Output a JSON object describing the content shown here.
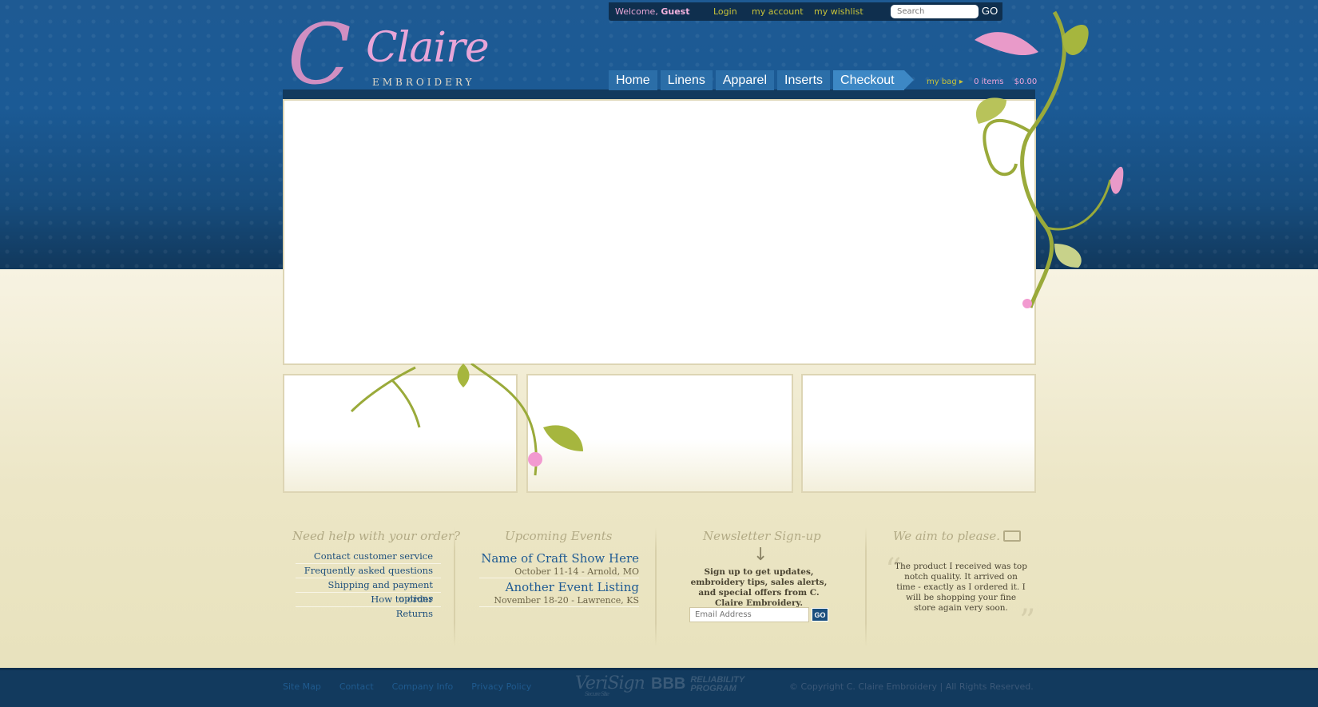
{
  "topbar": {
    "welcome_prefix": "Welcome,",
    "welcome_name": "Guest",
    "login": "Login",
    "my_account": "my account",
    "my_wishlist": "my wishlist",
    "search_placeholder": "Search",
    "search_go": "GO"
  },
  "logo": {
    "initial": "C",
    "name": "Claire",
    "tagline": "EMBROIDERY"
  },
  "nav": {
    "items": [
      "Home",
      "Linens",
      "Apparel",
      "Inserts",
      "Checkout"
    ]
  },
  "bag": {
    "label": "my bag",
    "items": "0 items",
    "total": "$0.00"
  },
  "help": {
    "title": "Need help with your order?",
    "links": [
      "Contact customer service",
      "Frequently asked questions",
      "Shipping and payment options",
      "How to order",
      "Returns"
    ]
  },
  "events": {
    "title": "Upcoming Events",
    "items": [
      {
        "name": "Name of Craft Show Here",
        "date": "October 11-14 - Arnold, MO"
      },
      {
        "name": "Another Event Listing",
        "date": "November 18-20 - Lawrence, KS"
      }
    ]
  },
  "newsletter": {
    "title": "Newsletter Sign-up",
    "text": "Sign up to get updates, embroidery tips, sales alerts, and special offers from C. Claire Embroidery.",
    "email_placeholder": "Email Address",
    "go": "GO"
  },
  "testimonial": {
    "title": "We aim to please.",
    "text": "The product I received was top notch quality. It arrived on time - exactly as I ordered it. I will be shopping your fine store again very soon."
  },
  "footer": {
    "links": [
      "Site Map",
      "Contact",
      "Company Info",
      "Privacy Policy"
    ],
    "verisign": "VeriSign",
    "verisign_sub": "Secure Site",
    "bbb": "BBB",
    "bbb_program": "RELIABILITY PROGRAM",
    "copyright": "© Copyright C. Claire Embroidery | All Rights Reserved."
  },
  "colors": {
    "header_blue": "#1b5a95",
    "nav_blue": "#2b6ea8",
    "checkout_blue": "#3d88c5",
    "cream": "#e8e2bd",
    "accent_pink": "#e8a5d8",
    "accent_olive": "#c7c23a"
  }
}
